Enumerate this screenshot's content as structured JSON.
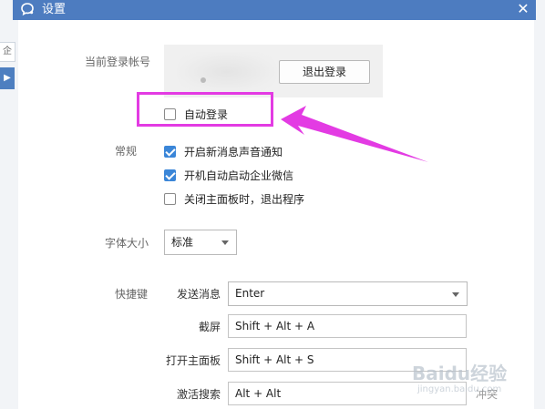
{
  "background": {
    "left_tab_text": "企",
    "left_selected_glyph": "▶"
  },
  "window": {
    "title": "设置",
    "title_bar_color": "#4d7cc0",
    "logo_icon": "wework-chat-bubble-icon",
    "close_icon": "close-icon",
    "close_glyph": "✕"
  },
  "account": {
    "label": "当前登录帐号",
    "logout_label": "退出登录",
    "auto_login_label": "自动登录",
    "auto_login_checked": false
  },
  "general": {
    "label": "常规",
    "options": [
      {
        "label": "开启新消息声音通知",
        "checked": true
      },
      {
        "label": "开机自动启动企业微信",
        "checked": true
      },
      {
        "label": "关闭主面板时，退出程序",
        "checked": false
      }
    ]
  },
  "font_size": {
    "label": "字体大小",
    "value": "标准"
  },
  "shortcuts": {
    "label": "快捷键",
    "items": [
      {
        "label": "发送消息",
        "value": "Enter",
        "dropdown": true
      },
      {
        "label": "截屏",
        "value": "Shift + Alt + A"
      },
      {
        "label": "打开主面板",
        "value": "Shift + Alt + S"
      },
      {
        "label": "激活搜索",
        "value": "Alt + Alt",
        "status": "冲突"
      }
    ]
  },
  "annotation": {
    "color": "#e33be3"
  },
  "watermark": {
    "line1": "Baidu经验",
    "line2": "jingyan.baidu.com"
  }
}
